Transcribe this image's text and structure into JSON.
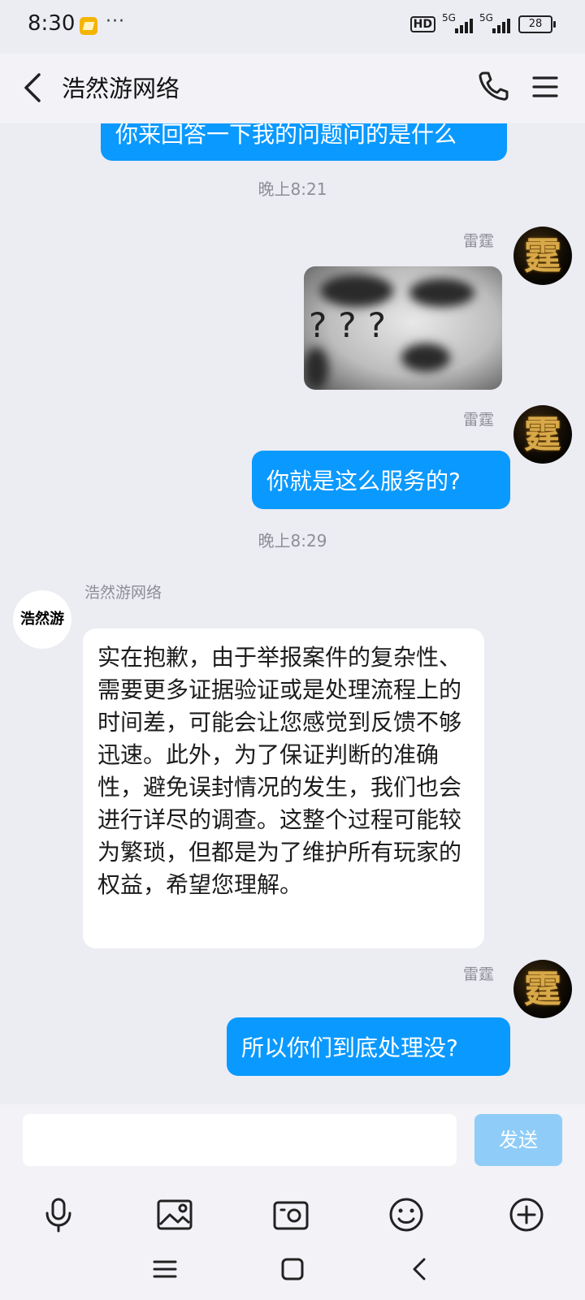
{
  "status_bar": {
    "time": "8:30",
    "dots": "···",
    "network_badge": "HD",
    "signal_label_1": "5G",
    "signal_label_2": "5G",
    "battery": "28"
  },
  "header": {
    "title": "浩然游网络"
  },
  "messages": {
    "partial_top": "你来回答一下我的问题问的是什么",
    "timestamp_1": "晚上8:21",
    "sender_me": "雷霆",
    "avatar_me_char": "霆",
    "sticker_text": "???",
    "msg_me_1": "你就是这么服务的?",
    "timestamp_2": "晚上8:29",
    "sender_company": "浩然游网络",
    "avatar_company_text": "浩然游",
    "msg_company_1": "实在抱歉，由于举报案件的复杂性、需要更多证据验证或是处理流程上的时间差，可能会让您感觉到反馈不够迅速。此外，为了保证判断的准确性，避免误封情况的发生，我们也会进行详尽的调查。这整个过程可能较为繁琐，但都是为了维护所有玩家的权益，希望您理解。",
    "msg_me_2": "所以你们到底处理没?"
  },
  "input": {
    "value": "",
    "send_label": "发送"
  },
  "colors": {
    "bubble_out": "#0a99ff",
    "send_disabled": "#8fcdf8",
    "background": "#ececf3"
  },
  "toolbar_icons": [
    "microphone-icon",
    "image-icon",
    "camera-icon",
    "emoji-icon",
    "plus-icon"
  ],
  "nav_icons": [
    "menu-icon",
    "home-icon",
    "back-icon"
  ]
}
